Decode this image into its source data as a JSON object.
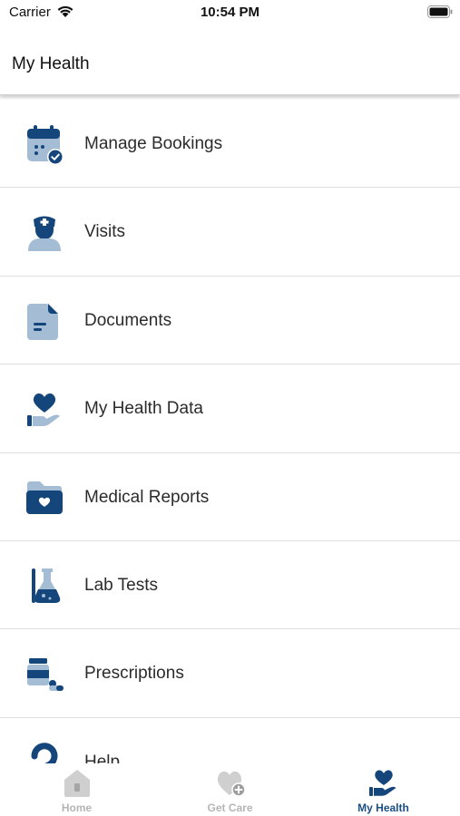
{
  "status_bar": {
    "carrier": "Carrier",
    "time": "10:54 PM"
  },
  "header": {
    "title": "My Health"
  },
  "menu": {
    "items": [
      {
        "label": "Manage Bookings",
        "icon": "calendar-check-icon"
      },
      {
        "label": "Visits",
        "icon": "doctor-icon"
      },
      {
        "label": "Documents",
        "icon": "document-icon"
      },
      {
        "label": "My Health Data",
        "icon": "heart-hand-icon"
      },
      {
        "label": "Medical Reports",
        "icon": "folder-heart-icon"
      },
      {
        "label": "Lab Tests",
        "icon": "flask-icon"
      },
      {
        "label": "Prescriptions",
        "icon": "pills-icon"
      },
      {
        "label": "Help",
        "icon": "help-icon"
      }
    ]
  },
  "tab_bar": {
    "tabs": [
      {
        "label": "Home",
        "icon": "home-icon",
        "active": false
      },
      {
        "label": "Get Care",
        "icon": "heart-plus-icon",
        "active": false
      },
      {
        "label": "My Health",
        "icon": "heart-hand-icon",
        "active": true
      }
    ]
  },
  "colors": {
    "primary": "#14467c",
    "secondary": "#a4bcd4",
    "inactive": "#b5b5b5"
  }
}
